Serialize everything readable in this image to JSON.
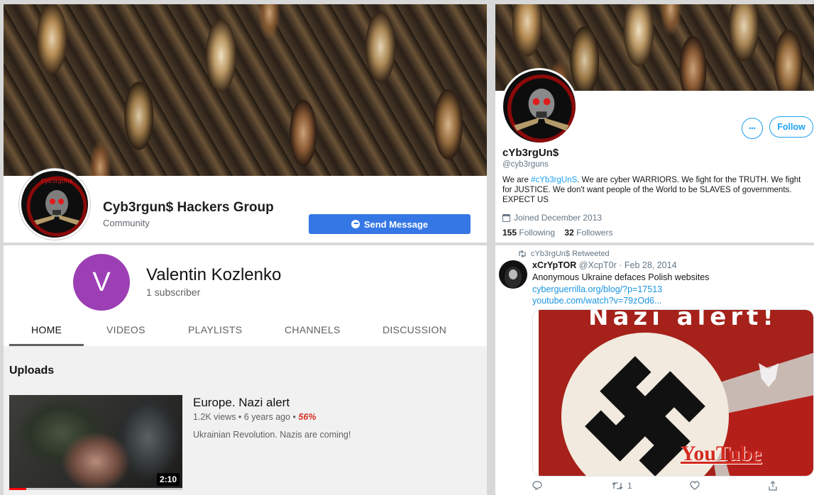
{
  "facebook": {
    "page_name": "Cyb3rgun$ Hackers Group",
    "category": "Community",
    "send_message_label": "Send Message",
    "avatar_banner_text": "Cyb3rgUn$"
  },
  "youtube": {
    "avatar_letter": "V",
    "channel_name": "Valentin Kozlenko",
    "subscribers": "1 subscriber",
    "tabs": [
      "HOME",
      "VIDEOS",
      "PLAYLISTS",
      "CHANNELS",
      "DISCUSSION"
    ],
    "section_title": "Uploads",
    "video": {
      "title": "Europe. Nazi alert",
      "views_age": "1.2K views • 6 years ago • ",
      "rating": "56%",
      "description": "Ukrainian Revolution. Nazis are coming!",
      "duration": "2:10",
      "watched_fraction": 0.1
    }
  },
  "twitter_profile": {
    "display_name": "cYb3rgUn$",
    "handle": "@cyb3rguns",
    "bio_prefix": "We are ",
    "bio_hashtag": "#cYb3rgUnS",
    "bio_rest": ". We are cyber WARRIORS. We fight for the TRUTH. We fight for JUSTICE. We don't want people of the World to be SLAVES of governments. EXPECT US",
    "joined": "Joined December 2013",
    "following_count": "155",
    "following_label": "Following",
    "followers_count": "32",
    "followers_label": "Followers",
    "follow_label": "Follow",
    "more_label": "•••"
  },
  "tweet": {
    "retweet_label": "cYb3rgUn$ Retweeted",
    "author_name": "xCrYpTOR",
    "author_meta": " @XcpT0r · Feb 28, 2014",
    "text": "Anonymous Ukraine defaces Polish websites",
    "link1": "cyberguerrilla.org/blog/?p=17513",
    "link2": "youtube.com/watch?v=79zOd6...",
    "card_title": "Nazi alert!",
    "card_brand": "YouTube",
    "retweet_count": "1"
  },
  "colors": {
    "facebook_blue": "#3578e5",
    "youtube_avatar": "#9c3fb5",
    "twitter_blue": "#1da1f2",
    "card_red": "#a5211a"
  }
}
